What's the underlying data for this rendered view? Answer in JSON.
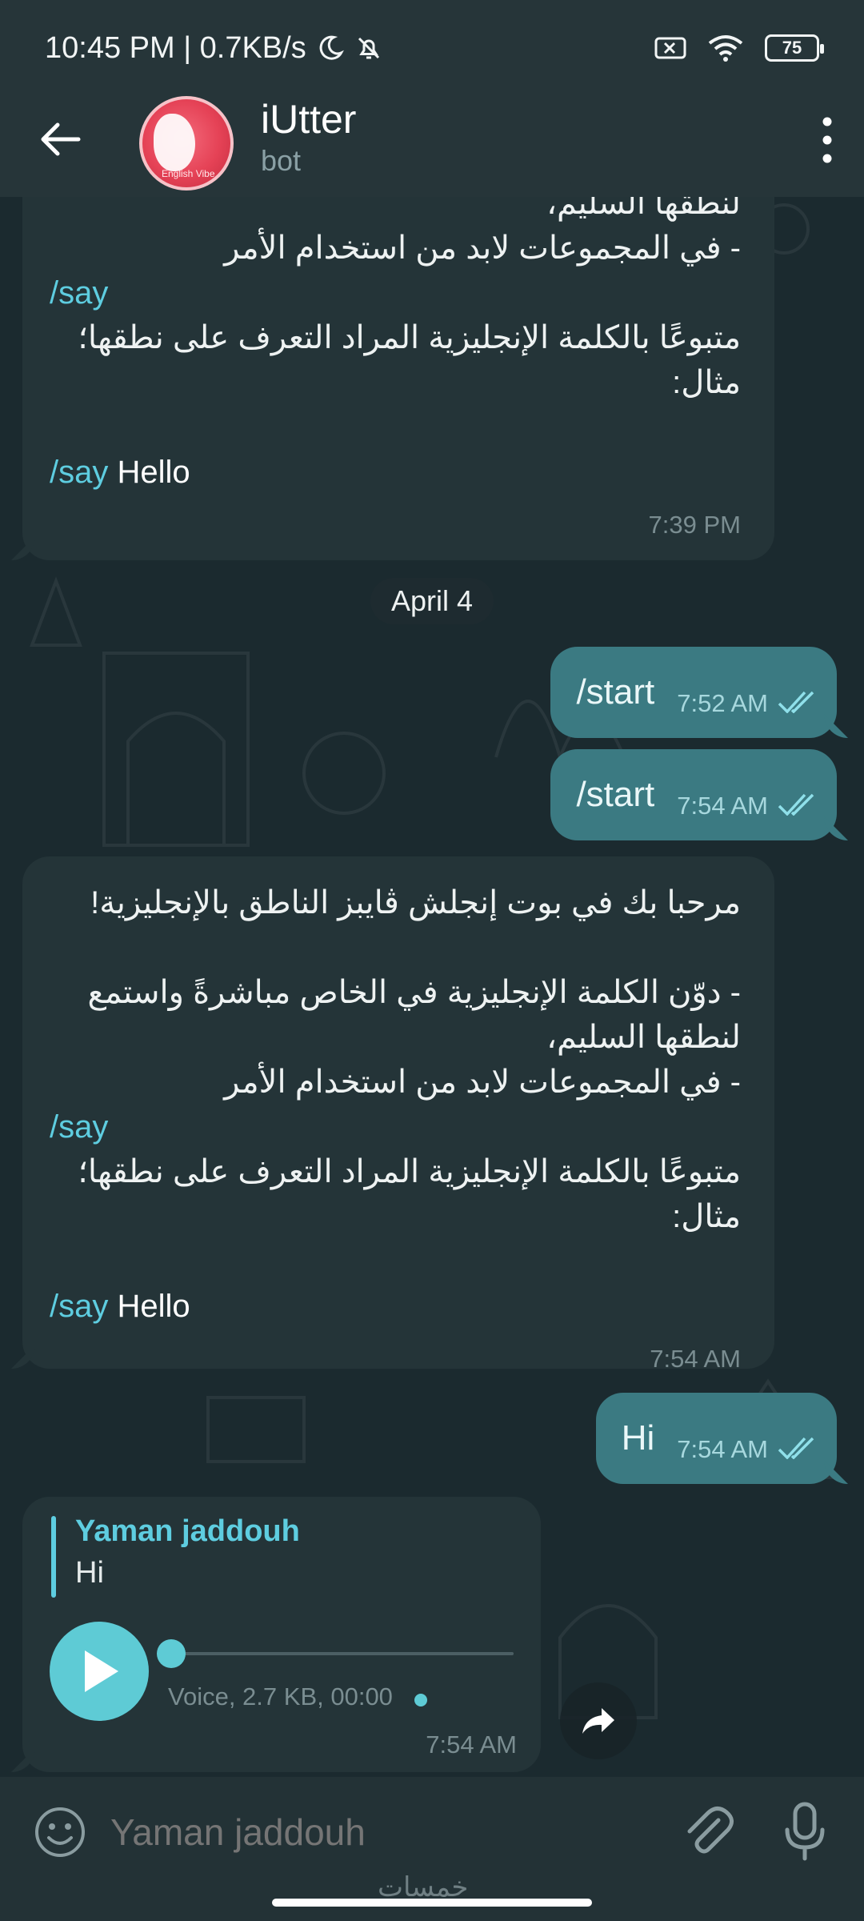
{
  "status_bar": {
    "time_speed": "10:45 PM | 0.7KB/s",
    "battery": "75"
  },
  "header": {
    "title": "iUtter",
    "subtitle": "bot",
    "avatar_tag": "English Vibe"
  },
  "messages": {
    "m1": {
      "line1": "لنطقها السليم،",
      "line2": "- في المجموعات لابد من استخدام الأمر",
      "cmd": "/say",
      "line3": "متبوعًا بالكلمة الإنجليزية المراد التعرف على نطقها؛",
      "line4": "مثال:",
      "example_cmd": "/say",
      "example_word": "Hello",
      "time": "7:39 PM"
    },
    "date_separator": "April 4",
    "out1": {
      "text": "/start",
      "time": "7:52 AM"
    },
    "out2": {
      "text": "/start",
      "time": "7:54 AM"
    },
    "m2": {
      "line0": "مرحبا بك في بوت إنجلش ڤايبز الناطق بالإنجليزية!",
      "line1": "- دوّن الكلمة الإنجليزية في الخاص مباشرةً واستمع",
      "line1b": "لنطقها السليم،",
      "line2": "- في المجموعات لابد من استخدام الأمر",
      "cmd": "/say",
      "line3": "متبوعًا بالكلمة الإنجليزية المراد التعرف على نطقها؛",
      "line4": "مثال:",
      "example_cmd": "/say",
      "example_word": "Hello",
      "time": "7:54 AM"
    },
    "out3": {
      "text": "Hi",
      "time": "7:54 AM"
    },
    "voice": {
      "reply_name": "Yaman jaddouh",
      "reply_text": "Hi",
      "info": "Voice, 2.7 KB, 00:00",
      "time": "7:54 AM"
    }
  },
  "composer": {
    "placeholder": "Yaman jaddouh",
    "watermark": "خمسات"
  },
  "colors": {
    "accent": "#5ecde0",
    "outgoing_bubble": "#3b7a82",
    "incoming_bubble": "#243438",
    "background": "#1b2a2f"
  }
}
